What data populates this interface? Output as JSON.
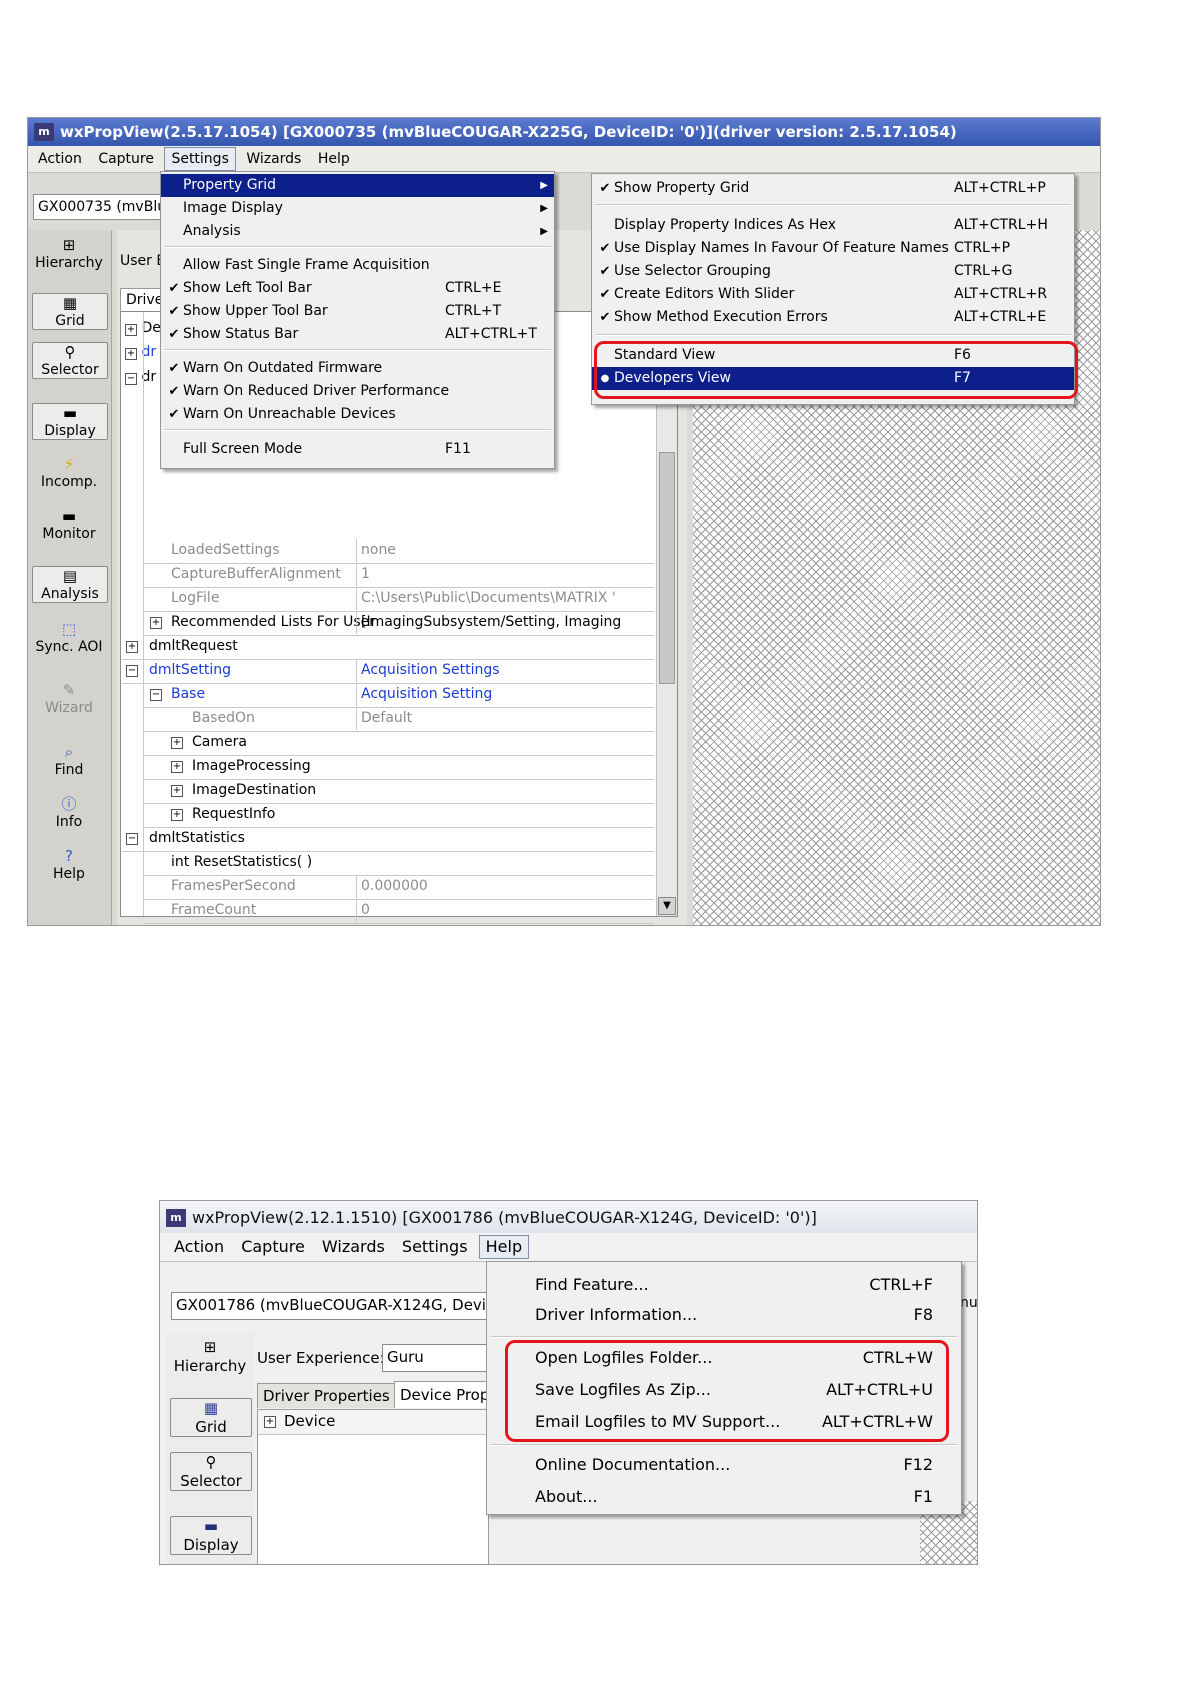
{
  "top": {
    "title": "wxPropView(2.5.17.1054) [GX000735 (mvBlueCOUGAR-X225G, DeviceID: '0')](driver version: 2.5.17.1054)",
    "menubar": [
      "Action",
      "Capture",
      "Settings",
      "Wizards",
      "Help"
    ],
    "device_field": "GX000735 (mvBlue",
    "user_label": "User E",
    "driver_tab": "Driver",
    "sidebar": [
      {
        "label": "Hierarchy",
        "icon": "hierarchy-icon"
      },
      {
        "label": "Grid",
        "icon": "grid-icon"
      },
      {
        "label": "Selector",
        "icon": "selector-icon"
      },
      {
        "label": "Display",
        "icon": "display-icon"
      },
      {
        "label": "Incomp.",
        "icon": "incomp-icon"
      },
      {
        "label": "Monitor",
        "icon": "monitor-icon"
      },
      {
        "label": "Analysis",
        "icon": "analysis-icon"
      },
      {
        "label": "Sync. AOI",
        "icon": "sync-aoi-icon"
      },
      {
        "label": "Wizard",
        "icon": "wizard-icon"
      },
      {
        "label": "Find",
        "icon": "find-icon"
      },
      {
        "label": "Info",
        "icon": "info-icon"
      },
      {
        "label": "Help",
        "icon": "help-icon"
      }
    ],
    "tree_stubs": [
      "De",
      "dr",
      "dr"
    ],
    "grid_rows": [
      {
        "name": "LoadedSettings",
        "value": "none"
      },
      {
        "name": "CaptureBufferAlignment",
        "value": "1"
      },
      {
        "name": "LogFile",
        "value": "C:\\Users\\Public\\Documents\\MATRIX '"
      },
      {
        "name": "Recommended Lists For User",
        "value": "[ImagingSubsystem/Setting, Imaging"
      },
      {
        "name": "dmltRequest",
        "value": ""
      },
      {
        "name": "dmltSetting",
        "value": "Acquisition Settings"
      },
      {
        "name": "Base",
        "value": "Acquisition Setting"
      },
      {
        "name": "BasedOn",
        "value": "Default"
      },
      {
        "name": "Camera",
        "value": ""
      },
      {
        "name": "ImageProcessing",
        "value": ""
      },
      {
        "name": "ImageDestination",
        "value": ""
      },
      {
        "name": "RequestInfo",
        "value": ""
      },
      {
        "name": "dmltStatistics",
        "value": ""
      },
      {
        "name": "int ResetStatistics( )",
        "value": ""
      },
      {
        "name": "FramesPerSecond",
        "value": "0.000000"
      },
      {
        "name": "FrameCount",
        "value": "0"
      }
    ],
    "settings_menu": [
      {
        "label": "Property Grid",
        "shortcut": "",
        "check": "",
        "arrow": "▶"
      },
      {
        "label": "Image Display",
        "shortcut": "",
        "check": "",
        "arrow": "▶"
      },
      {
        "label": "Analysis",
        "shortcut": "",
        "check": "",
        "arrow": "▶"
      },
      {
        "label": "Allow Fast Single Frame Acquisition",
        "shortcut": "",
        "check": "",
        "arrow": ""
      },
      {
        "label": "Show Left Tool Bar",
        "shortcut": "CTRL+E",
        "check": "✔",
        "arrow": ""
      },
      {
        "label": "Show Upper Tool Bar",
        "shortcut": "CTRL+T",
        "check": "✔",
        "arrow": ""
      },
      {
        "label": "Show Status Bar",
        "shortcut": "ALT+CTRL+T",
        "check": "✔",
        "arrow": ""
      },
      {
        "label": "Warn On Outdated Firmware",
        "shortcut": "",
        "check": "✔",
        "arrow": ""
      },
      {
        "label": "Warn On Reduced Driver Performance",
        "shortcut": "",
        "check": "✔",
        "arrow": ""
      },
      {
        "label": "Warn On Unreachable Devices",
        "shortcut": "",
        "check": "✔",
        "arrow": ""
      },
      {
        "label": "Full Screen Mode",
        "shortcut": "F11",
        "check": "",
        "arrow": ""
      }
    ],
    "grid_submenu": [
      {
        "label": "Show Property Grid",
        "shortcut": "ALT+CTRL+P",
        "check": "✔"
      },
      {
        "label": "Display Property Indices As Hex",
        "shortcut": "ALT+CTRL+H",
        "check": ""
      },
      {
        "label": "Use Display Names In Favour Of Feature Names",
        "shortcut": "CTRL+P",
        "check": "✔"
      },
      {
        "label": "Use Selector Grouping",
        "shortcut": "CTRL+G",
        "check": "✔"
      },
      {
        "label": "Create Editors With Slider",
        "shortcut": "ALT+CTRL+R",
        "check": "✔"
      },
      {
        "label": "Show Method Execution Errors",
        "shortcut": "ALT+CTRL+E",
        "check": "✔"
      },
      {
        "label": "Standard View",
        "shortcut": "F6",
        "check": ""
      },
      {
        "label": "Developers View",
        "shortcut": "F7",
        "check": "●"
      }
    ]
  },
  "bottom": {
    "title": "wxPropView(2.12.1.1510) [GX001786 (mvBlueCOUGAR-X124G, DeviceID: '0')]",
    "menubar": [
      "Action",
      "Capture",
      "Wizards",
      "Settings",
      "Help"
    ],
    "device_field": "GX001786 (mvBlueCOUGAR-X124G, Devicel",
    "right_stub": "nu",
    "user_exp_label": "User Experience:",
    "user_exp_value": "Guru",
    "tabs": [
      "Driver Properties",
      "Device Prop"
    ],
    "tree_device": "Device",
    "sidebar": [
      {
        "label": "Hierarchy",
        "icon": "hierarchy-icon"
      },
      {
        "label": "Grid",
        "icon": "grid-icon"
      },
      {
        "label": "Selector",
        "icon": "selector-icon"
      },
      {
        "label": "Display",
        "icon": "display-icon"
      }
    ],
    "help_menu": [
      {
        "label": "Find Feature...",
        "shortcut": "CTRL+F"
      },
      {
        "label": "Driver Information...",
        "shortcut": "F8"
      },
      {
        "label": "Open Logfiles Folder...",
        "shortcut": "CTRL+W"
      },
      {
        "label": "Save Logfiles As Zip...",
        "shortcut": "ALT+CTRL+U"
      },
      {
        "label": "Email Logfiles to MV Support...",
        "shortcut": "ALT+CTRL+W"
      },
      {
        "label": "Online Documentation...",
        "shortcut": "F12"
      },
      {
        "label": "About...",
        "shortcut": "F1"
      }
    ]
  },
  "colors": {
    "highlight": "#0d1f8a",
    "annotation": "#e3141c",
    "link": "#1a3bd6"
  }
}
